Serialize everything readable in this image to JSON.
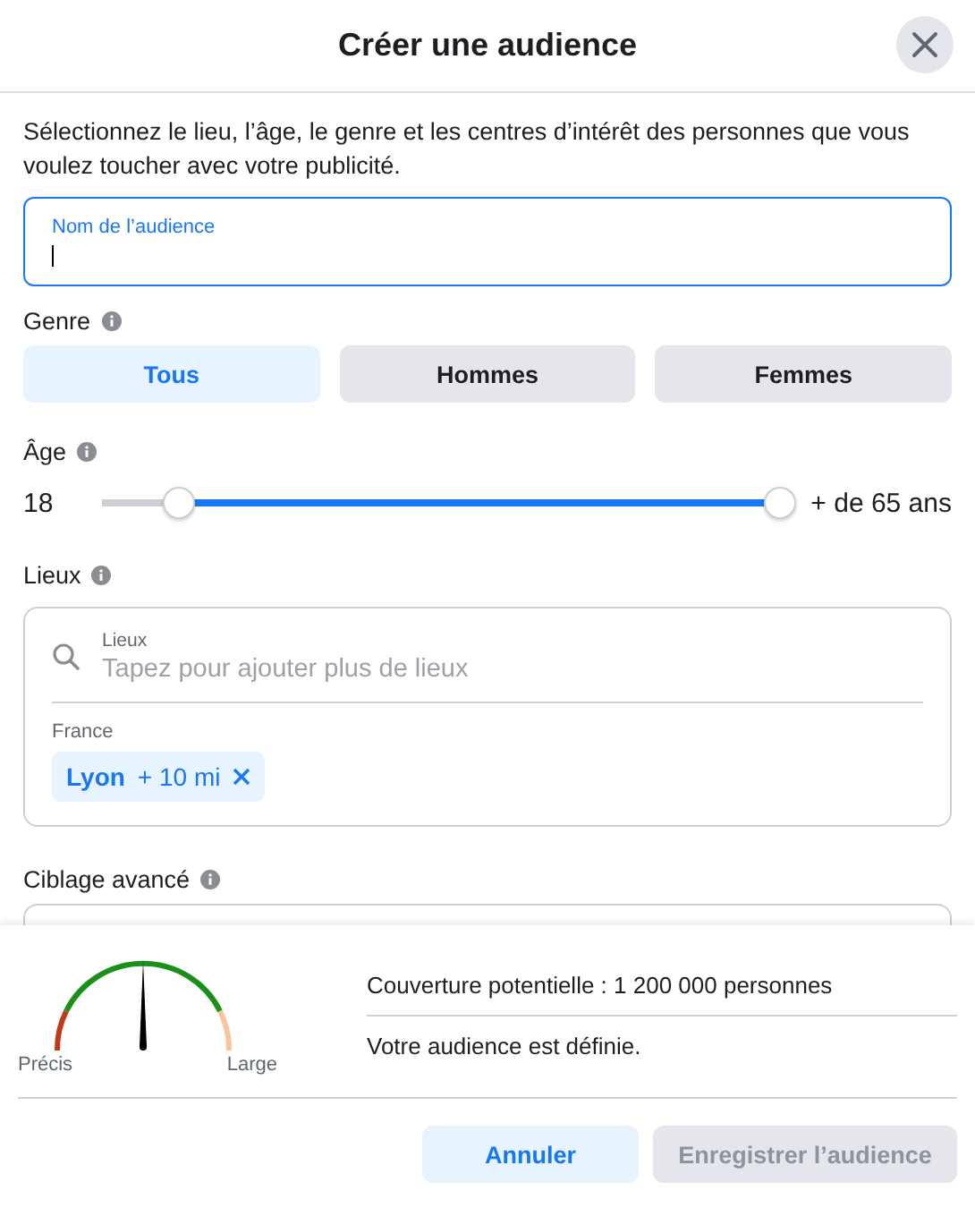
{
  "dialog": {
    "title": "Créer une audience"
  },
  "intro": "Sélectionnez le lieu, l’âge, le genre et les centres d’intérêt des personnes que vous voulez toucher avec votre publicité.",
  "name_field": {
    "label": "Nom de l’audience",
    "focused": true
  },
  "gender": {
    "label": "Genre",
    "options": [
      {
        "label": "Tous",
        "selected": true
      },
      {
        "label": "Hommes",
        "selected": false
      },
      {
        "label": "Femmes",
        "selected": false
      }
    ]
  },
  "age": {
    "label": "Âge",
    "min_reading": "18",
    "max_reading": "+ de 65 ans",
    "thumbs": [
      {
        "level": 0.115
      },
      {
        "level": 1
      }
    ]
  },
  "locations": {
    "label": "Lieux",
    "search_label": "Lieux",
    "placeholder": "Tapez pour ajouter plus de lieux",
    "country": "France",
    "chips": [
      {
        "name": "Lyon",
        "radius": "+ 10 mi"
      }
    ]
  },
  "advanced": {
    "label": "Ciblage avancé"
  },
  "gauge": {
    "left_label": "Précis",
    "right_label": "Large"
  },
  "reach": "Couverture potentielle : 1 200 000 personnes",
  "status": "Votre audience est définie.",
  "buttons": [
    {
      "label": "Annuler",
      "kind": "secondary",
      "disabled": false
    },
    {
      "label": "Enregistrer l’audience",
      "kind": "primary",
      "disabled": true
    }
  ]
}
